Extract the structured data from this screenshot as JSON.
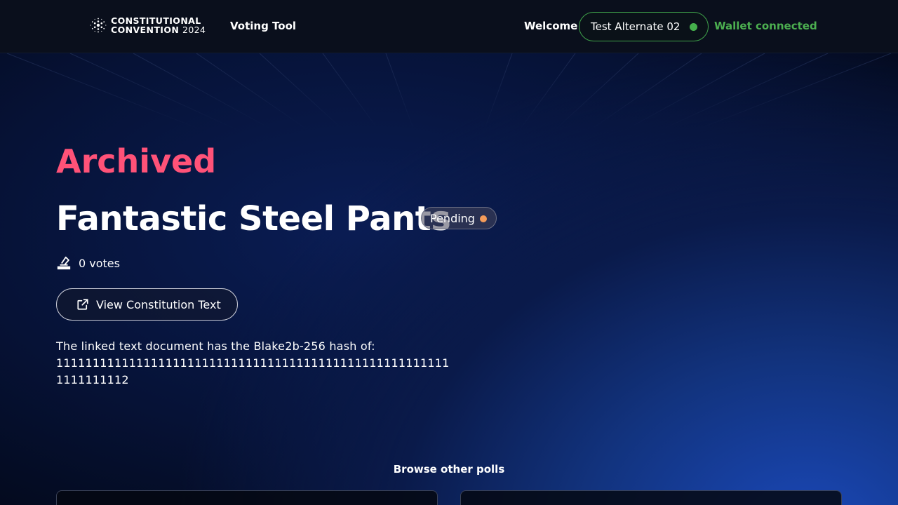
{
  "header": {
    "logo_line1": "CONSTITUTIONAL",
    "logo_line2": "CONVENTION",
    "logo_year": "2024",
    "nav_link": "Voting Tool",
    "welcome": "Welcome",
    "user_name": "Test Alternate 02",
    "wallet_status": "Wallet connected"
  },
  "poll": {
    "state_heading": "Archived",
    "title": "Fantastic Steel Pants",
    "status": "Pending",
    "votes": "0 votes",
    "view_button": "View Constitution Text",
    "hash_label": "The linked text document has the Blake2b-256 hash of:",
    "hash_value": "1111111111111111111111111111111111111111111111111111111111111112"
  },
  "browse": {
    "heading": "Browse other polls"
  },
  "colors": {
    "archived": "#ff5278",
    "connected": "#45b04c",
    "pending_dot": "#f59c5a"
  },
  "icons": {
    "vote": "ballot-box-icon",
    "external": "external-link-icon",
    "user_status": "status-dot-icon"
  }
}
